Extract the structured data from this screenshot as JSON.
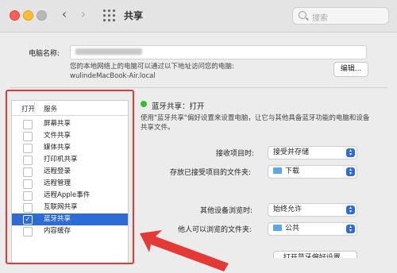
{
  "window": {
    "title": "共享",
    "search_placeholder": "搜索"
  },
  "computer": {
    "name_label": "电脑名称:",
    "hint_line1": "您的本地网络上的电脑可以通过以下地址访问您的电脑:",
    "hint_line2": "wulindeMacBook-Air.local",
    "edit_button": "编辑..."
  },
  "services": {
    "header_on": "打开",
    "header_service": "服务",
    "items": [
      {
        "label": "屏幕共享",
        "checked": false,
        "selected": false
      },
      {
        "label": "文件共享",
        "checked": false,
        "selected": false
      },
      {
        "label": "媒体共享",
        "checked": false,
        "selected": false
      },
      {
        "label": "打印机共享",
        "checked": false,
        "selected": false
      },
      {
        "label": "远程登录",
        "checked": false,
        "selected": false
      },
      {
        "label": "远程管理",
        "checked": false,
        "selected": false
      },
      {
        "label": "远程Apple事件",
        "checked": false,
        "selected": false
      },
      {
        "label": "互联网共享",
        "checked": false,
        "selected": false
      },
      {
        "label": "蓝牙共享",
        "checked": true,
        "selected": true
      },
      {
        "label": "内容缓存",
        "checked": false,
        "selected": false
      }
    ],
    "checkmark": "✓"
  },
  "detail": {
    "status": "蓝牙共享：打开",
    "desc_line1": "使用\"蓝牙共享\"偏好设置来设置电脑，让它与其他具备蓝牙功能的电脑和设备",
    "desc_line2": "共享文件。",
    "receive_label": "接收项目时:",
    "receive_value": "接受并存储",
    "store_label": "存放已接受项目的文件夹:",
    "store_value": "下载",
    "browse_label": "其他设备浏览时:",
    "browse_value": "始终允许",
    "others_label": "他人可以浏览的文件夹:",
    "others_value": "公共",
    "open_button": "打开蓝牙偏好设置..."
  },
  "colors": {
    "selection": "#2d6bd6",
    "annotation": "#e53935",
    "status_on": "#2ec02e"
  }
}
